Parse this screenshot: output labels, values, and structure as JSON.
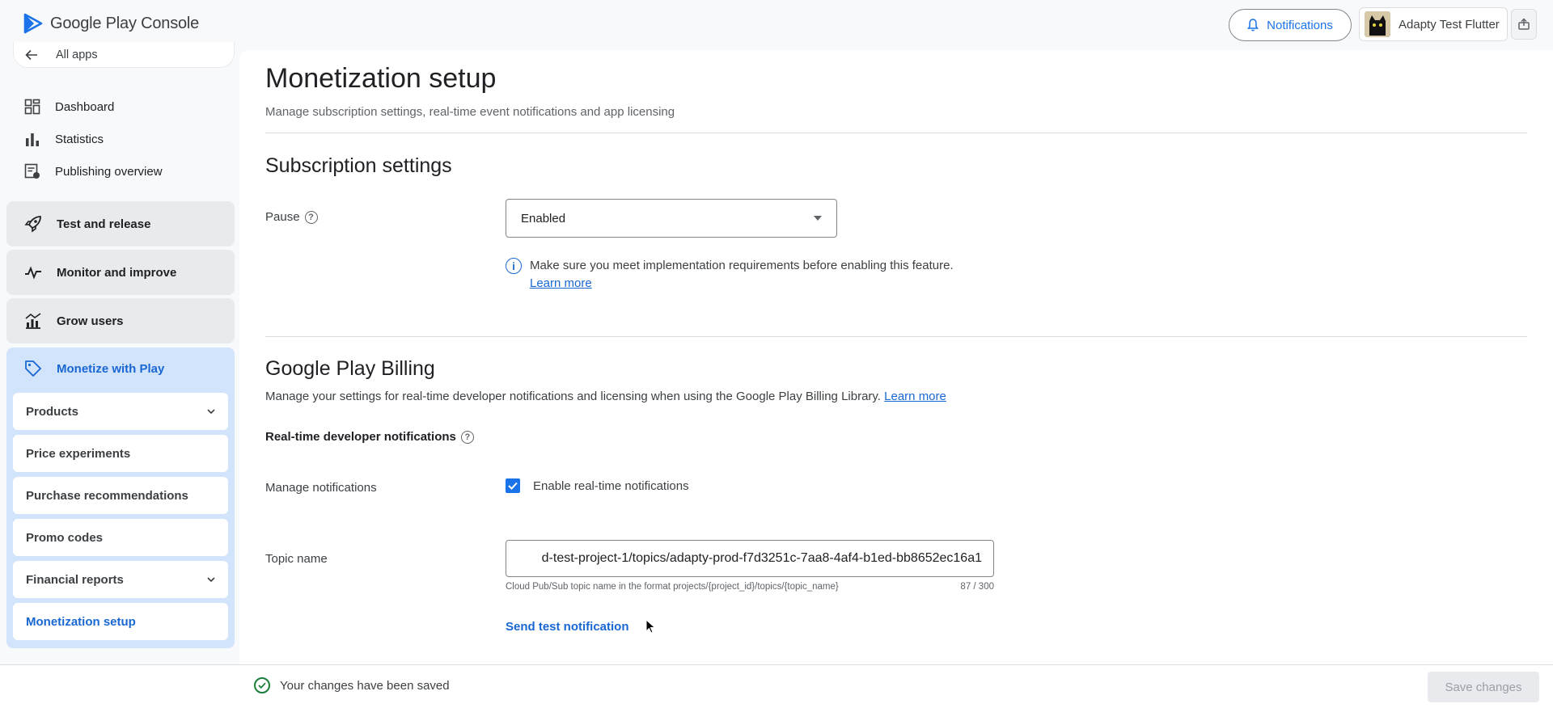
{
  "header": {
    "logo_text": "Google Play Console",
    "notifications_label": "Notifications",
    "account_name": "Adapty Test Flutter",
    "accent_color": "#1a73e8"
  },
  "sidebar": {
    "all_apps": "All apps",
    "items": [
      {
        "label": "Dashboard",
        "icon": "dashboard-icon"
      },
      {
        "label": "Statistics",
        "icon": "bar-chart-icon"
      },
      {
        "label": "Publishing overview",
        "icon": "publishing-icon"
      }
    ],
    "groups": [
      {
        "label": "Test and release",
        "icon": "rocket-icon"
      },
      {
        "label": "Monitor and improve",
        "icon": "pulse-icon"
      },
      {
        "label": "Grow users",
        "icon": "grow-icon"
      }
    ],
    "monetize": {
      "label": "Monetize with Play",
      "icon": "tag-icon",
      "items": [
        {
          "label": "Products",
          "expandable": true
        },
        {
          "label": "Price experiments"
        },
        {
          "label": "Purchase recommendations"
        },
        {
          "label": "Promo codes"
        },
        {
          "label": "Financial reports",
          "expandable": true
        },
        {
          "label": "Monetization setup",
          "active": true
        }
      ]
    }
  },
  "main": {
    "title": "Monetization setup",
    "subtitle": "Manage subscription settings, real-time event notifications and app licensing",
    "subscription": {
      "heading": "Subscription settings",
      "pause_label": "Pause",
      "pause_value": "Enabled",
      "info_text": "Make sure you meet implementation requirements before enabling this feature.",
      "info_link": "Learn more"
    },
    "billing": {
      "heading": "Google Play Billing",
      "description": "Manage your settings for real-time developer notifications and licensing when using the Google Play Billing Library.",
      "description_link": "Learn more",
      "rtdn_label": "Real-time developer notifications",
      "manage_label": "Manage notifications",
      "enable_label": "Enable real-time notifications",
      "enable_checked": true,
      "topic_label": "Topic name",
      "topic_value": "d-test-project-1/topics/adapty-prod-f7d3251c-7aa8-4af4-b1ed-bb8652ec16a1",
      "topic_helper": "Cloud Pub/Sub topic name in the format projects/{project_id}/topics/{topic_name}",
      "topic_count": "87 / 300",
      "send_test": "Send test notification"
    }
  },
  "footer": {
    "saved_message": "Your changes have been saved",
    "save_button": "Save changes"
  }
}
